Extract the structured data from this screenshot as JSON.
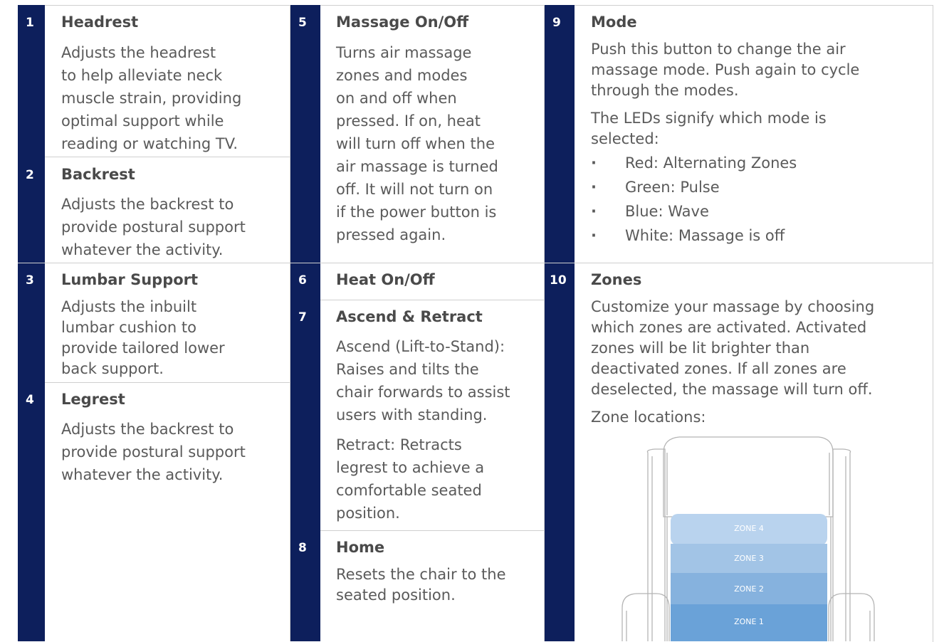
{
  "sections": [
    {
      "num": "1",
      "title": "Headrest",
      "body": "Adjusts the headrest\nto help alleviate neck\nmuscle strain, providing\noptimal support while\nreading or watching TV."
    },
    {
      "num": "2",
      "title": "Backrest",
      "body": "Adjusts the backrest to\nprovide postural support\nwhatever the activity."
    },
    {
      "num": "3",
      "title": "Lumbar Support",
      "body": "Adjusts the inbuilt\nlumbar cushion to\nprovide tailored lower\nback support."
    },
    {
      "num": "4",
      "title": "Legrest",
      "body": "Adjusts the backrest to\nprovide postural support\nwhatever the activity."
    },
    {
      "num": "5",
      "title": "Massage On/Off",
      "body": "Turns air massage\nzones and modes\non and off when\npressed. If on, heat\nwill turn off when the\nair massage is turned\noff. It will not turn on\nif the power button is\npressed again."
    },
    {
      "num": "6",
      "title": "Heat On/Off"
    },
    {
      "num": "7",
      "title": "Ascend & Retract",
      "body": "Ascend (Lift-to-Stand):\nRaises and tilts the\nchair forwards to assist\nusers with standing.",
      "body2": "Retract: Retracts\nlegrest to achieve a\ncomfortable seated\nposition."
    },
    {
      "num": "8",
      "title": "Home",
      "body": "Resets the chair to the\nseated position."
    },
    {
      "num": "9",
      "title": "Mode",
      "body": "Push this button to change the air\nmassage mode. Push again to cycle\nthrough the modes.",
      "body2": "The LEDs signify which mode is\nselected:",
      "bullets": [
        "Red: Alternating Zones",
        "Green: Pulse",
        "Blue: Wave",
        "White: Massage is off"
      ]
    },
    {
      "num": "10",
      "title": "Zones",
      "body": "Customize your massage by choosing\nwhich zones are activated. Activated\nzones will be lit brighter than\ndeactivated zones. If all zones are\ndeselected, the massage will turn off.",
      "body2": "Zone locations:"
    }
  ],
  "zones": [
    "ZONE 4",
    "ZONE 3",
    "ZONE 2",
    "ZONE 1"
  ],
  "colors": {
    "band": "#0d1f5c",
    "zone4": "#b9d3ee",
    "zone3": "#a2c4e6",
    "zone2": "#86b2de",
    "zone1": "#6aa2d8"
  }
}
